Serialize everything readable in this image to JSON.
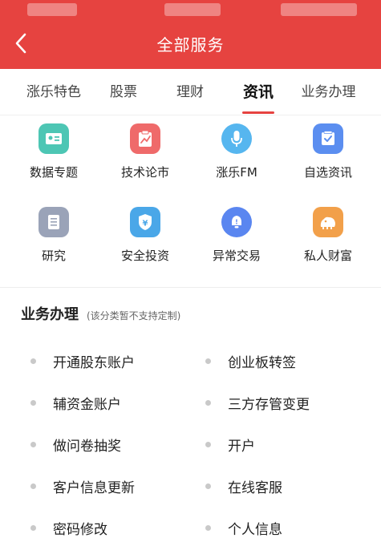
{
  "header": {
    "title": "全部服务",
    "background_color": "#e64340"
  },
  "tabs": [
    {
      "label": "涨乐特色",
      "active": false
    },
    {
      "label": "股票",
      "active": false
    },
    {
      "label": "理财",
      "active": false
    },
    {
      "label": "资讯",
      "active": true
    },
    {
      "label": "业务办理",
      "active": false
    }
  ],
  "grid_items": [
    {
      "label": "数据专题",
      "icon": "id-card-icon",
      "color": "#4dc6b4"
    },
    {
      "label": "技术论市",
      "icon": "chart-trend-icon",
      "color": "#ef6a6a"
    },
    {
      "label": "涨乐FM",
      "icon": "microphone-icon",
      "color": "#56b6ef"
    },
    {
      "label": "自选资讯",
      "icon": "checkbox-icon",
      "color": "#5b8ef0"
    },
    {
      "label": "研究",
      "icon": "document-icon",
      "color": "#9aa3b8"
    },
    {
      "label": "安全投资",
      "icon": "shield-yen-icon",
      "color": "#4aa7e8"
    },
    {
      "label": "异常交易",
      "icon": "bell-alert-icon",
      "color": "#5a86f0"
    },
    {
      "label": "私人财富",
      "icon": "lion-icon",
      "color": "#f2a04a"
    }
  ],
  "business": {
    "title": "业务办理",
    "note": "(该分类暂不支持定制)",
    "items": [
      "开通股东账户",
      "创业板转签",
      "辅资金账户",
      "三方存管变更",
      "做问卷抽奖",
      "开户",
      "客户信息更新",
      "在线客服",
      "密码修改",
      "个人信息"
    ]
  }
}
